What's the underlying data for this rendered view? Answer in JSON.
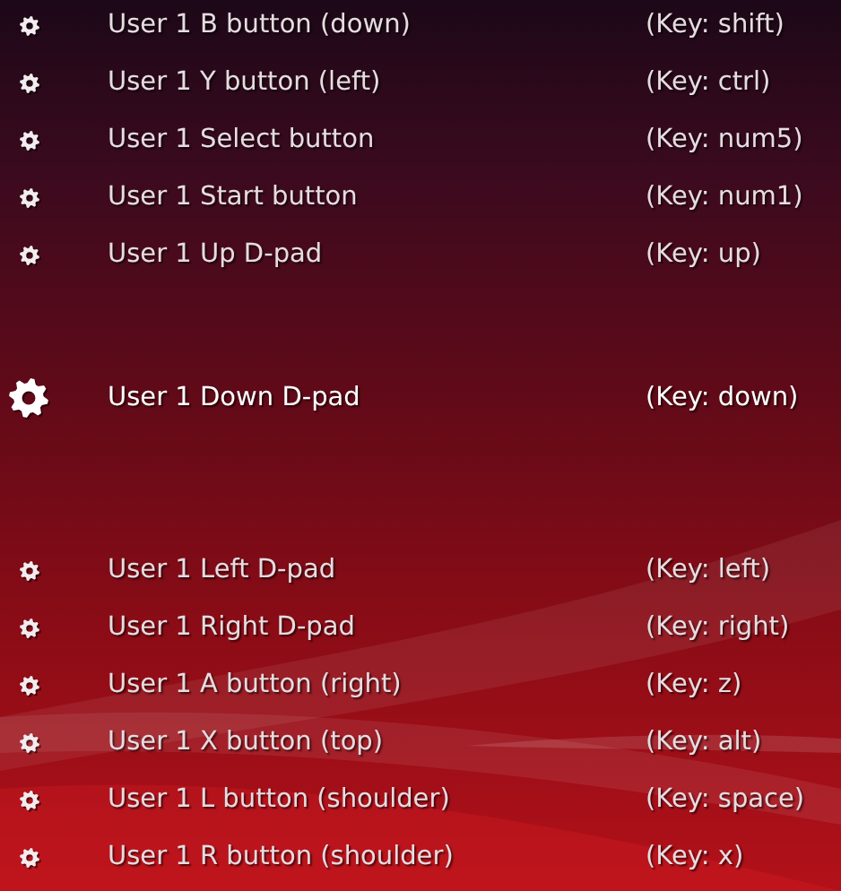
{
  "items": [
    {
      "label": "User 1 B button (down)",
      "value": "(Key: shift)",
      "selected": false
    },
    {
      "label": "User 1 Y button (left)",
      "value": "(Key: ctrl)",
      "selected": false
    },
    {
      "label": "User 1 Select button",
      "value": "(Key: num5)",
      "selected": false
    },
    {
      "label": "User 1 Start button",
      "value": "(Key: num1)",
      "selected": false
    },
    {
      "label": "User 1 Up D-pad",
      "value": "(Key: up)",
      "selected": false
    },
    {
      "label": "User 1 Down D-pad",
      "value": "(Key: down)",
      "selected": true
    },
    {
      "label": "User 1 Left D-pad",
      "value": "(Key: left)",
      "selected": false
    },
    {
      "label": "User 1 Right D-pad",
      "value": "(Key: right)",
      "selected": false
    },
    {
      "label": "User 1 A button (right)",
      "value": "(Key: z)",
      "selected": false
    },
    {
      "label": "User 1 X button (top)",
      "value": "(Key: alt)",
      "selected": false
    },
    {
      "label": "User 1 L button (shoulder)",
      "value": "(Key: space)",
      "selected": false
    },
    {
      "label": "User 1 R button (shoulder)",
      "value": "(Key: x)",
      "selected": false
    }
  ]
}
